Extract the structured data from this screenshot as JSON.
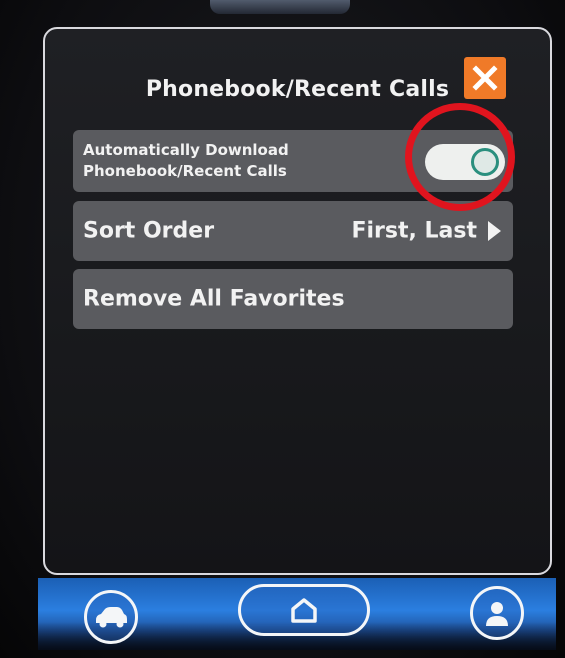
{
  "dialog": {
    "title": "Phonebook/Recent Calls",
    "close_icon": "close-x-icon"
  },
  "settings": {
    "auto_download": {
      "label_line1": "Automatically Download",
      "label_line2": "Phonebook/Recent Calls",
      "enabled": true
    },
    "sort_order": {
      "label": "Sort Order",
      "value": "First, Last"
    },
    "remove_favorites": {
      "label": "Remove All Favorites"
    }
  },
  "nav": {
    "left_icon": "car-icon",
    "center_icon": "home-icon",
    "right_icon": "person-icon"
  },
  "colors": {
    "close_button": "#f07a28",
    "highlight_ring": "#e0141e",
    "toggle_knob": "#2a8f7e",
    "nav_bar": "#2b7fe0"
  }
}
